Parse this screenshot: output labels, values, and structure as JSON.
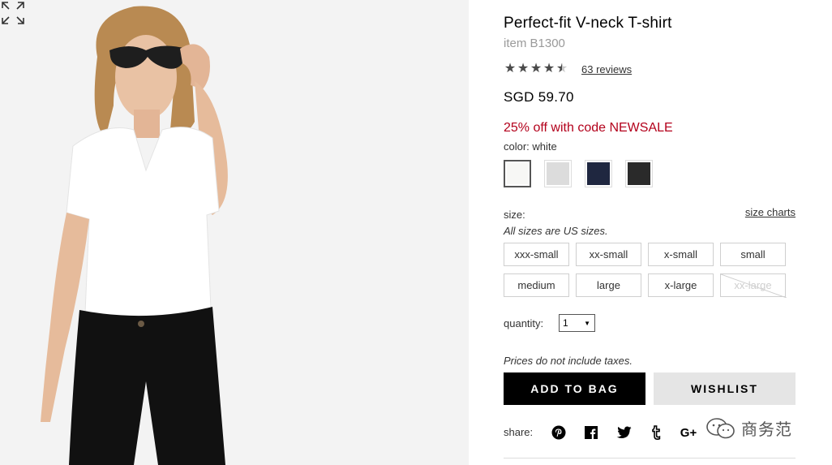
{
  "product": {
    "title": "Perfect-fit V-neck T-shirt",
    "item_code": "item B1300",
    "rating": 4.5,
    "reviews_text": "63 reviews",
    "price": "SGD 59.70",
    "promo": "25% off with code NEWSALE",
    "color_label": "color: white"
  },
  "swatches": [
    {
      "name": "white",
      "color": "#f7f7f5",
      "selected": true
    },
    {
      "name": "heather gray",
      "color": "#dcdcdc",
      "selected": false
    },
    {
      "name": "navy",
      "color": "#1f2740",
      "selected": false
    },
    {
      "name": "black",
      "color": "#2a2a2a",
      "selected": false
    }
  ],
  "size": {
    "label": "size:",
    "charts_link": "size charts",
    "note": "All sizes are US sizes.",
    "options": [
      {
        "label": "xxx-small",
        "available": true
      },
      {
        "label": "xx-small",
        "available": true
      },
      {
        "label": "x-small",
        "available": true
      },
      {
        "label": "small",
        "available": true
      },
      {
        "label": "medium",
        "available": true
      },
      {
        "label": "large",
        "available": true
      },
      {
        "label": "x-large",
        "available": true
      },
      {
        "label": "xx-large",
        "available": false
      }
    ]
  },
  "quantity": {
    "label": "quantity:",
    "value": "1"
  },
  "tax_note": "Prices do not include taxes.",
  "buttons": {
    "add_to_bag": "ADD TO BAG",
    "wishlist": "WISHLIST"
  },
  "share": {
    "label": "share:",
    "icons": [
      "pinterest-icon",
      "facebook-icon",
      "twitter-icon",
      "tumblr-icon",
      "google-plus-icon"
    ],
    "google_plus_text": "G+"
  },
  "watermark": {
    "text": "商务范"
  },
  "colors": {
    "promo": "#b3001b",
    "button_primary": "#000000",
    "button_secondary": "#e5e5e5"
  }
}
